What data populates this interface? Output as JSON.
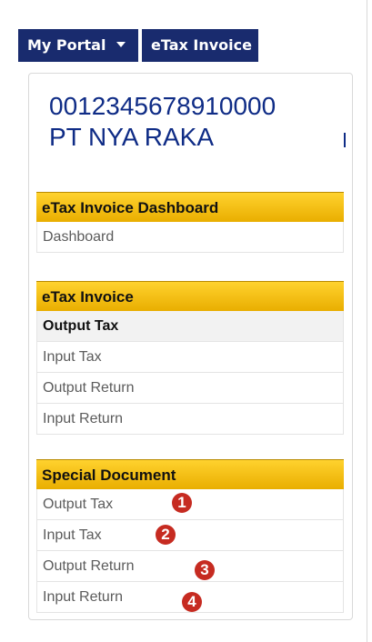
{
  "nav": {
    "portal_label": "My Portal",
    "etax_label": "eTax Invoice"
  },
  "company": {
    "npwp": "0012345678910000",
    "name": "PT NYA RAKA"
  },
  "dashboard_section": {
    "header": "eTax Invoice Dashboard",
    "items": [
      "Dashboard"
    ]
  },
  "etax_section": {
    "header": "eTax Invoice",
    "active_item": "Output Tax",
    "items": [
      "Output Tax",
      "Input Tax",
      "Output Return",
      "Input Return"
    ]
  },
  "special_section": {
    "header": "Special Document",
    "items": [
      "Output Tax",
      "Input Tax",
      "Output Return",
      "Input Return"
    ],
    "badges": [
      "1",
      "2",
      "3",
      "4"
    ]
  },
  "colors": {
    "nav_bg": "#192b6e",
    "header_gold": "#f2c200",
    "company_text": "#0f2c86",
    "badge_red": "#c62b21"
  }
}
